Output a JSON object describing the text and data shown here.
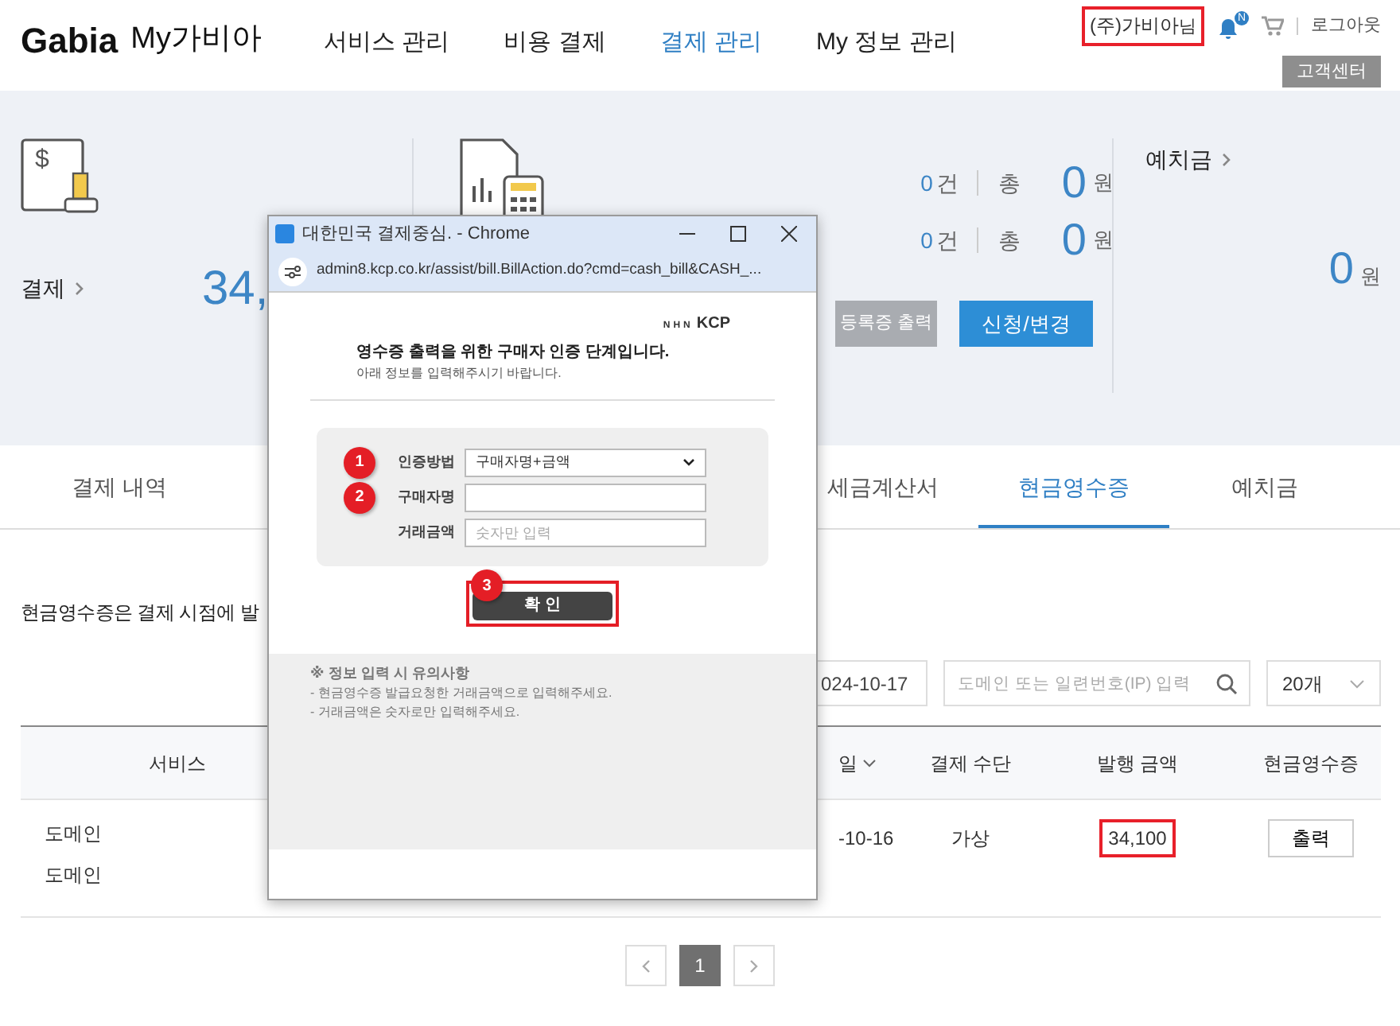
{
  "header": {
    "logo": "Gabia",
    "logo_sub": "My가비아",
    "nav": [
      {
        "label": "서비스 관리",
        "selected": false
      },
      {
        "label": "비용 결제",
        "selected": false
      },
      {
        "label": "결제 관리",
        "selected": true
      },
      {
        "label": "My 정보 관리",
        "selected": false
      }
    ],
    "user": {
      "name": "(주)가비아",
      "suffix": "님",
      "highlighted": true
    },
    "notification_badge": "N",
    "logout": "로그아웃",
    "support_button": "고객센터"
  },
  "summary": {
    "payment": {
      "icon_symbol": "$",
      "label": "결제",
      "amount": "34,"
    },
    "billing": {
      "stats": [
        {
          "count": "0",
          "count_unit": "건",
          "total_label": "총",
          "total": "0",
          "currency": "원"
        },
        {
          "count": "0",
          "count_unit": "건",
          "total_label": "총",
          "total": "0",
          "currency": "원"
        }
      ],
      "buttons": [
        {
          "label": "등록증 출력",
          "kind": "secondary"
        },
        {
          "label": "신청/변경",
          "kind": "primary"
        }
      ]
    },
    "deposit": {
      "label": "예치금",
      "amount": "0",
      "currency": "원"
    }
  },
  "tabs": [
    {
      "label": "결제 내역",
      "selected": false
    },
    {
      "label": "세금계산서",
      "selected": false
    },
    {
      "label": "현금영수증",
      "selected": true
    },
    {
      "label": "예치금",
      "selected": false
    }
  ],
  "notice": "현금영수증은 결제 시점에 발",
  "filters": {
    "date": "024-10-17",
    "search": {
      "placeholder": "도메인 또는 일련번호(IP) 입력"
    },
    "page_size": "20개"
  },
  "table": {
    "columns": [
      "서비스",
      "일",
      "결제 수단",
      "발행 금액",
      "현금영수증"
    ],
    "rows": [
      {
        "services": [
          "도메인",
          "도메인"
        ],
        "date": "-10-16",
        "method": "가상",
        "amount": "34,100",
        "amount_highlighted": true,
        "action": "출력"
      }
    ]
  },
  "pagination": {
    "pages": [
      {
        "label": "1",
        "selected": true
      }
    ]
  },
  "popup": {
    "title": "대한민국 결제중심. - Chrome",
    "url": "admin8.kcp.co.kr/assist/bill.BillAction.do?cmd=cash_bill&CASH_...",
    "logo_prefix": "NHN",
    "logo": "KCP",
    "heading": "영수증 출력을 위한 구매자 인증 단계입니다.",
    "subheading": "아래 정보를 입력해주시기 바랍니다.",
    "fields": [
      {
        "kind": "select",
        "label": "인증방법",
        "value": "구매자명+금액",
        "step": "1"
      },
      {
        "kind": "input",
        "label": "구매자명",
        "step": "2"
      },
      {
        "kind": "input",
        "label": "거래금액",
        "placeholder": "숫자만 입력"
      }
    ],
    "confirm": {
      "label": "확 인",
      "step": "3",
      "highlighted": true
    },
    "notes_title": "※ 정보 입력 시 유의사항",
    "notes": [
      "- 현금영수증 발급요청한 거래금액으로 입력해주세요.",
      "- 거래금액은 숫자로만 입력해주세요."
    ]
  }
}
